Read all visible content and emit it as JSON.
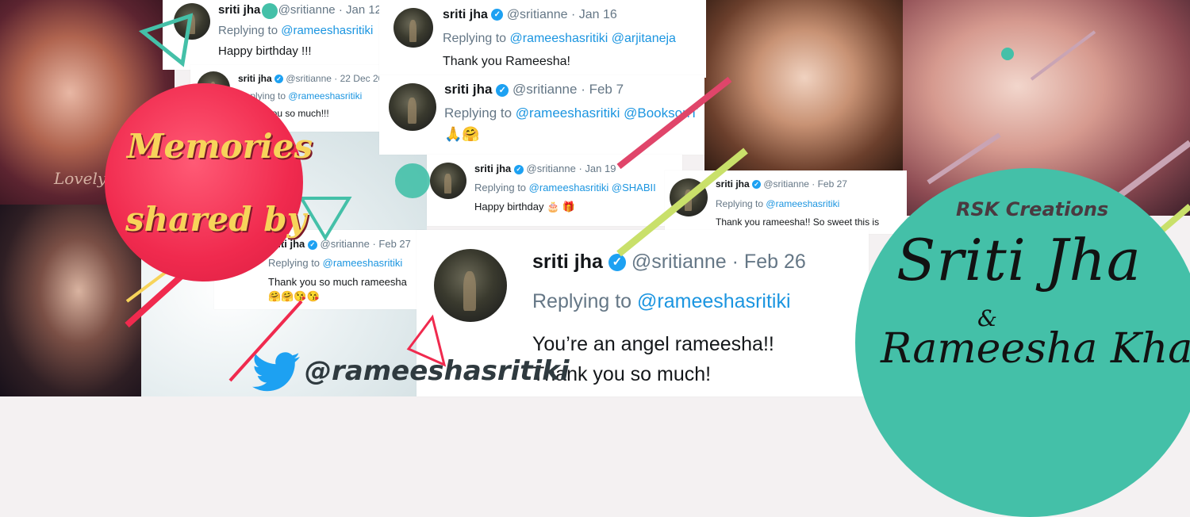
{
  "colors": {
    "pink": "#f02a4e",
    "teal": "#44c0a8",
    "yellow": "#f7d45a",
    "twitter_blue": "#1da1f2",
    "lime": "#c9e06a"
  },
  "overlay": {
    "memories_line1": "Memories",
    "memories_line2": "shared by",
    "lovely": "Lovely",
    "rsk": "RSK Creations",
    "title_line1": "Sriti Jha",
    "ampersand": "&",
    "title_line2": "Rameesha Khan",
    "handle": "@rameeshasritiki",
    "twitter_icon": "twitter-bird-icon"
  },
  "tweets": [
    {
      "name": "sriti jha",
      "handle": "@sritianne",
      "date": "· Jan 12",
      "reply": "Replying to",
      "mention": "@rameeshasritiki",
      "mention2": "",
      "text": "Happy birthday !!!"
    },
    {
      "name": "sriti jha",
      "handle": "@sritianne",
      "date": "· 22 Dec 2017",
      "reply": "Replying to",
      "mention": "@rameeshasritiki",
      "mention2": "",
      "text": "Thank you so much!!!"
    },
    {
      "name": "sriti jha",
      "handle": "@sritianne",
      "date": "· Jan 16",
      "reply": "Replying to",
      "mention": "@rameeshasritiki",
      "mention2": "@arjitaneja",
      "text": "Thank you Rameesha!"
    },
    {
      "name": "sriti jha",
      "handle": "@sritianne",
      "date": "· Feb 7",
      "reply": "Replying to",
      "mention": "@rameeshasritiki",
      "mention2": "@BooksonT",
      "text": "🙏🤗"
    },
    {
      "name": "sriti jha",
      "handle": "@sritianne",
      "date": "· Jan 19",
      "reply": "Replying to",
      "mention": "@rameeshasritiki",
      "mention2": "@SHABII",
      "text": "Happy birthday 🎂 🎁"
    },
    {
      "name": "sriti jha",
      "handle": "@sritianne",
      "date": "· Feb 27",
      "reply": "Replying to",
      "mention": "@rameeshasritiki",
      "mention2": "",
      "text": "Thank you rameesha!! So sweet this is"
    },
    {
      "name": "sriti jha",
      "handle": "@sritianne",
      "date": "· Feb 27",
      "reply": "Replying to",
      "mention": "@rameeshasritiki",
      "mention2": "",
      "text": "Thank you so much rameesha",
      "text2": "🤗🤗😘😘"
    },
    {
      "name": "sriti jha",
      "handle": "@sritianne",
      "date": "· Feb 26",
      "reply": "Replying to",
      "mention": "@rameeshasritiki",
      "mention2": "",
      "text": "You’re an angel rameesha!!",
      "text2": "Thank you so much!"
    }
  ]
}
